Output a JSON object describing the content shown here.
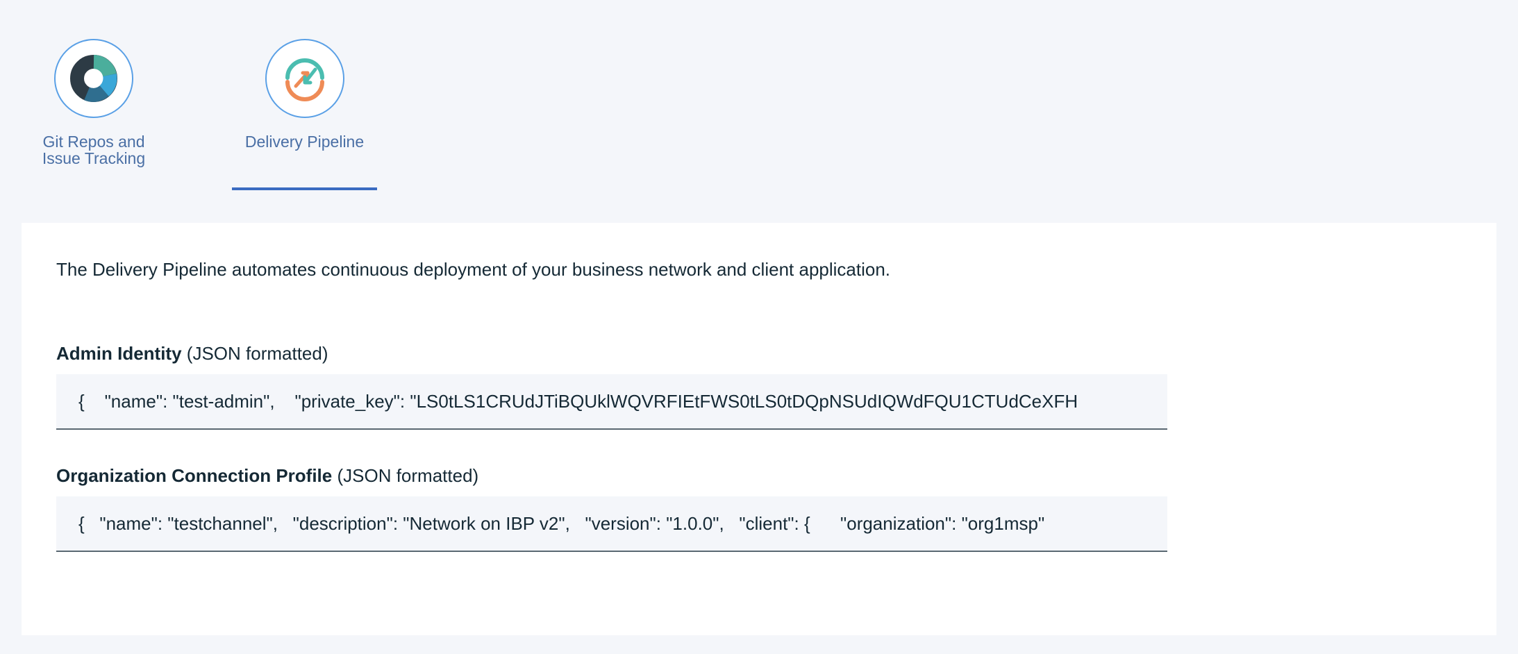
{
  "tabs": [
    {
      "label": "Git Repos and\nIssue Tracking",
      "icon": "git-repos-icon",
      "selected": false
    },
    {
      "label": "Delivery Pipeline",
      "icon": "delivery-pipeline-icon",
      "selected": true
    }
  ],
  "panel": {
    "intro": "The Delivery Pipeline automates continuous deployment of your business network and client application.",
    "admin_identity": {
      "label_bold": "Admin Identity",
      "label_suffix": " (JSON formatted)",
      "value": "{    \"name\": \"test-admin\",    \"private_key\": \"LS0tLS1CRUdJTiBQUklWQVRFIEtFWS0tLS0tDQpNSUdIQWdFQU1CTUdCeXFH"
    },
    "connection_profile": {
      "label_bold": "Organization Connection Profile",
      "label_suffix": " (JSON formatted)",
      "value": "{   \"name\": \"testchannel\",   \"description\": \"Network on IBP v2\",   \"version\": \"1.0.0\",   \"client\": {      \"organization\": \"org1msp\""
    }
  },
  "colors": {
    "accent": "#3a6bc1",
    "tab_label": "#4a6fa5",
    "icon_ring": "#5aa0e6",
    "background": "#f4f6fa",
    "text": "#152935"
  }
}
